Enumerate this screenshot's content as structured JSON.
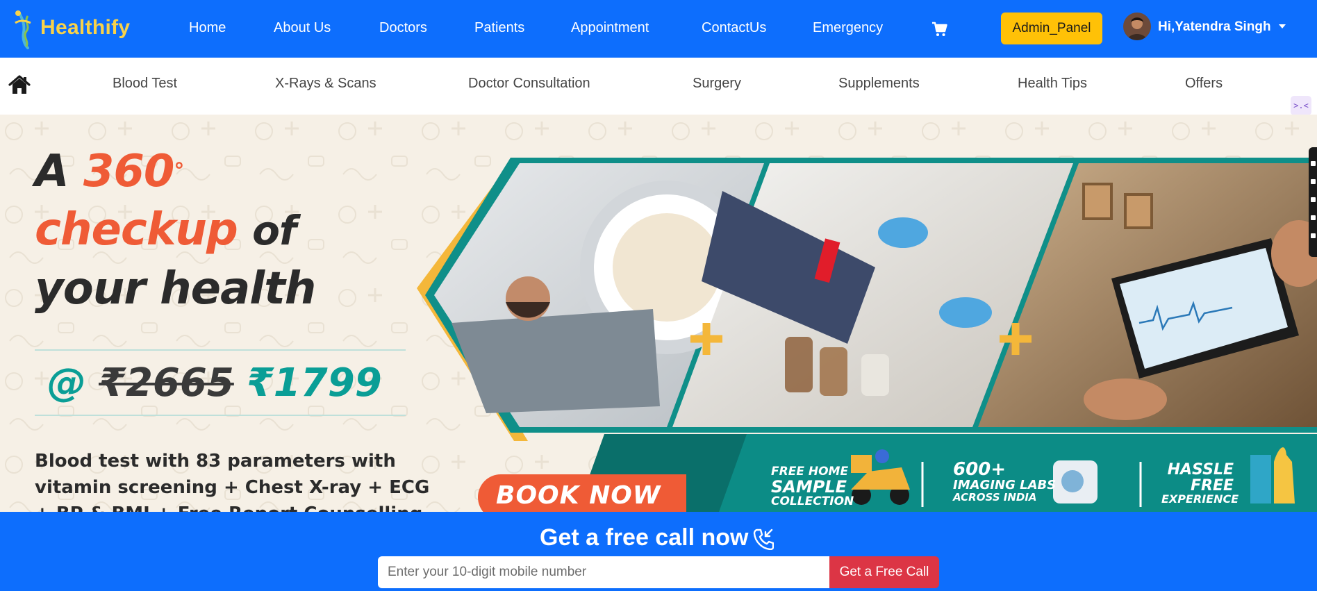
{
  "brand": {
    "name": "Healthify",
    "logo_icon": "caduceus-icon"
  },
  "navbar": {
    "links": [
      "Home",
      "About Us",
      "Doctors",
      "Patients",
      "Appointment",
      "ContactUs",
      "Emergency"
    ],
    "cart_icon": "cart-icon",
    "admin_label": "Admin_Panel",
    "user_greeting": "Hi,Yatendra Singh"
  },
  "categories": {
    "home_icon": "home-icon",
    "items": [
      "Blood Test",
      "X-Rays & Scans",
      "Doctor Consultation",
      "Surgery",
      "Supplements",
      "Health Tips",
      "Offers"
    ]
  },
  "hero": {
    "line1_a": "A",
    "line1_b": "360",
    "line1_deg": "°",
    "line2_a": "checkup",
    "line2_b": "of",
    "line3": "your health",
    "price_at": "@",
    "price_old": "₹2665",
    "price_new": "₹1799",
    "description": "Blood test with 83 parameters with vitamin screening + Chest X-ray + ECG + BP & BMI + Free Report Counselling",
    "cta": "BOOK NOW",
    "feature1": [
      "FREE HOME",
      "SAMPLE",
      "COLLECTION"
    ],
    "feature2": [
      "600+",
      "IMAGING LABS",
      "ACROSS INDIA"
    ],
    "feature3": [
      "HASSLE",
      "FREE",
      "EXPERIENCE"
    ]
  },
  "free_call": {
    "title": "Get a free call now",
    "input_placeholder": "Enter your 10-digit mobile number",
    "button_label": "Get a Free Call"
  },
  "colors": {
    "primary": "#0d6efd",
    "brand_text": "#f7d24a",
    "admin_button": "#ffc107",
    "cta_orange": "#ef5b36",
    "teal": "#0a9e96",
    "call_button": "#dc3545"
  }
}
